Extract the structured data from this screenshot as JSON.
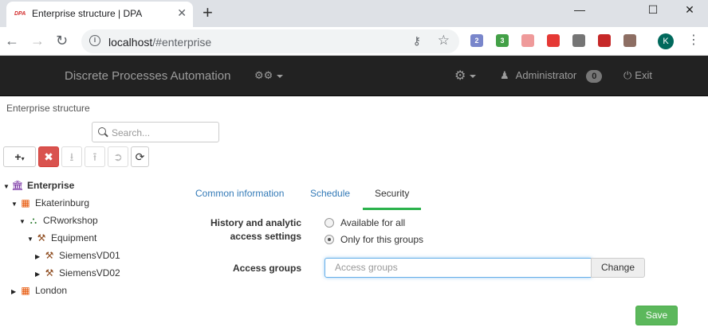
{
  "browser": {
    "tab_title": "Enterprise structure | DPA",
    "tab_favicon": "DPA",
    "url_host": "localhost",
    "url_path": "/#enterprise",
    "new_tab": "+",
    "profile_initial": "K",
    "extensions": [
      {
        "name": "mail-extension-icon",
        "badge": "2",
        "color": "#7986cb"
      },
      {
        "name": "counter-extension-icon",
        "badge": "3",
        "color": "#43a047"
      },
      {
        "name": "pen-extension-icon",
        "badge": "",
        "color": "#ef9a9a"
      },
      {
        "name": "adblock-extension-icon",
        "badge": "",
        "color": "#e53935"
      },
      {
        "name": "circle-extension-icon",
        "badge": "",
        "color": "#757575"
      },
      {
        "name": "pdf-extension-icon",
        "badge": "",
        "color": "#c62828"
      },
      {
        "name": "reader-extension-icon",
        "badge": "",
        "color": "#8d6e63"
      }
    ]
  },
  "navbar": {
    "brand": "Discrete Processes Automation",
    "user": "Administrator",
    "notifications": "0",
    "exit": "Exit"
  },
  "breadcrumb": "Enterprise structure",
  "search": {
    "placeholder": "Search..."
  },
  "tree": [
    {
      "label": "Enterprise",
      "icon": "enterprise-icon",
      "expanded": true
    },
    {
      "label": "Ekaterinburg",
      "icon": "building-icon",
      "expanded": true
    },
    {
      "label": "CRworkshop",
      "icon": "workshop-icon",
      "expanded": true
    },
    {
      "label": "Equipment",
      "icon": "equipment-icon",
      "expanded": true
    },
    {
      "label": "SiemensVD01",
      "icon": "machine-icon",
      "expanded": false
    },
    {
      "label": "SiemensVD02",
      "icon": "machine-icon",
      "expanded": false
    },
    {
      "label": "London",
      "icon": "building-icon",
      "expanded": false
    }
  ],
  "tabs": [
    "Common information",
    "Schedule",
    "Security"
  ],
  "active_tab": "Security",
  "security": {
    "history_label": "History and analytic access settings",
    "history_label_line1": "History and analytic",
    "history_label_line2": "access settings",
    "option_all": "Available for all",
    "option_groups": "Only for this groups",
    "selected_option": "Only for this groups",
    "access_groups_label": "Access groups",
    "access_groups_placeholder": "Access groups",
    "change_button": "Change"
  },
  "save_button": "Save",
  "colors": {
    "navbar": "#222222",
    "accent": "#2bb24c",
    "danger": "#d9534f",
    "save": "#5cb85c"
  }
}
